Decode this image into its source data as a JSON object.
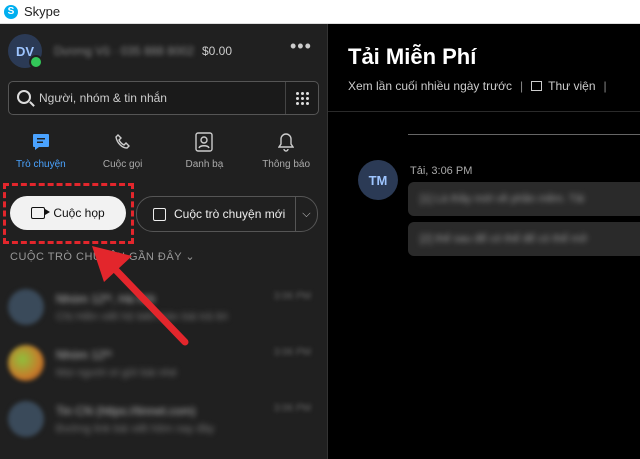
{
  "window": {
    "title": "Skype"
  },
  "profile": {
    "initials": "DV",
    "name": "Dương Vũ · 035 888 8002",
    "balance": "$0.00"
  },
  "search": {
    "placeholder": "Người, nhóm & tin nhắn"
  },
  "tabs": [
    {
      "label": "Trò chuyện",
      "icon": "chat-icon",
      "active": true
    },
    {
      "label": "Cuộc gọi",
      "icon": "phone-icon",
      "active": false
    },
    {
      "label": "Danh bạ",
      "icon": "contacts-icon",
      "active": false
    },
    {
      "label": "Thông báo",
      "icon": "bell-icon",
      "active": false
    }
  ],
  "actions": {
    "meet_label": "Cuộc họp",
    "new_chat_label": "Cuộc trò chuyện mới"
  },
  "recent": {
    "heading": "CUỘC TRÒ CHUYỆN GẦN ĐÂY",
    "items": [
      {
        "name": "Nhóm 12ᵗʰ, Hà Nội",
        "message": "Chị Hiền viết hộ biên bản bài trả lời",
        "time": "3:06 PM"
      },
      {
        "name": "Nhóm 12ᵗʰ",
        "message": "Mọi người ơi gửi bài nhé",
        "time": "3:06 PM"
      },
      {
        "name": "Tin CN (https://tinnet.com)",
        "message": "Đường link bài viết hôm nay đây",
        "time": "3:06 PM"
      }
    ]
  },
  "conversation": {
    "title": "Tải Miễn Phí",
    "last_seen": "Xem lần cuối nhiều ngày trước",
    "library_label": "Thư viện",
    "sender_initials": "TM",
    "meta": "Tải, 3:06 PM",
    "messages": [
      "[1] Là thầy mới về phần mềm. Tải",
      "[2] thế sau để có thể để có thể mở"
    ]
  },
  "colors": {
    "accent": "#4aa3ff",
    "highlight": "#e3262c",
    "online": "#33c759"
  }
}
